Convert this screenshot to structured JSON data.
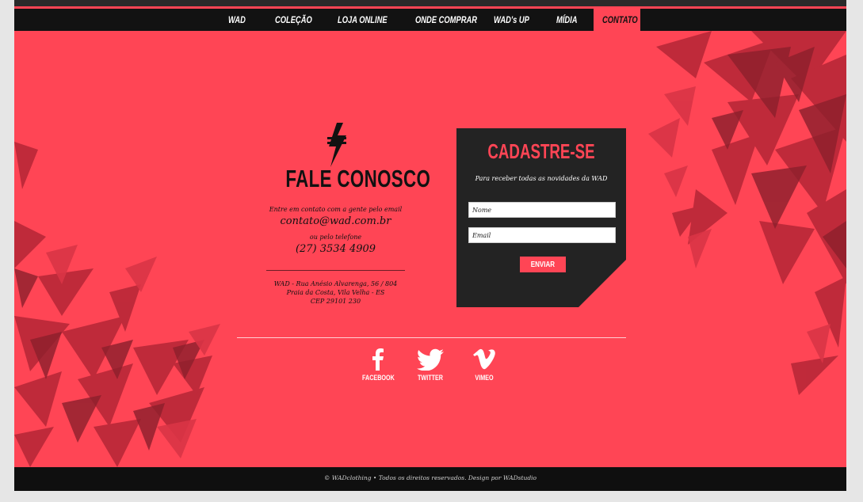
{
  "nav": {
    "items": [
      {
        "label": "WAD"
      },
      {
        "label": "COLEÇÃO"
      },
      {
        "label": "LOJA ONLINE"
      },
      {
        "label": "ONDE COMPRAR"
      },
      {
        "label": "WAD's UP"
      },
      {
        "label": "MÍDIA"
      },
      {
        "label": "CONTATO",
        "active": true
      }
    ]
  },
  "contact": {
    "icon": "lightning-bolt-logo-icon",
    "title": "FALE CONOSCO",
    "email_intro": "Entre em contato com a gente pelo email",
    "email": "contato@wad.com.br",
    "phone_intro": "ou pelo telefone",
    "phone": "(27) 3534 4909",
    "address_line1": "WAD - Rua Anésio Alvarenga, 56 / 804",
    "address_line2": "Praia da Costa, Vila Velha - ES",
    "address_line3": "CEP 29101 230"
  },
  "signup": {
    "title": "CADASTRE-SE",
    "subtitle": "Para receber todas as novidades da WAD",
    "name_placeholder": "Nome",
    "email_placeholder": "Email",
    "submit_label": "ENVIAR"
  },
  "social": [
    {
      "label": "FACEBOOK",
      "icon": "facebook-icon"
    },
    {
      "label": "TWITTER",
      "icon": "twitter-bird-icon"
    },
    {
      "label": "VIMEO",
      "icon": "vimeo-icon"
    }
  ],
  "footer": {
    "text": "© WADclothing • Todos os direitos reservados.     Design por WADstudio"
  },
  "colors": {
    "accent": "#ff4555",
    "dark": "#222222",
    "nav_bg": "#121212",
    "shard_dark": "#8c1f2c"
  }
}
